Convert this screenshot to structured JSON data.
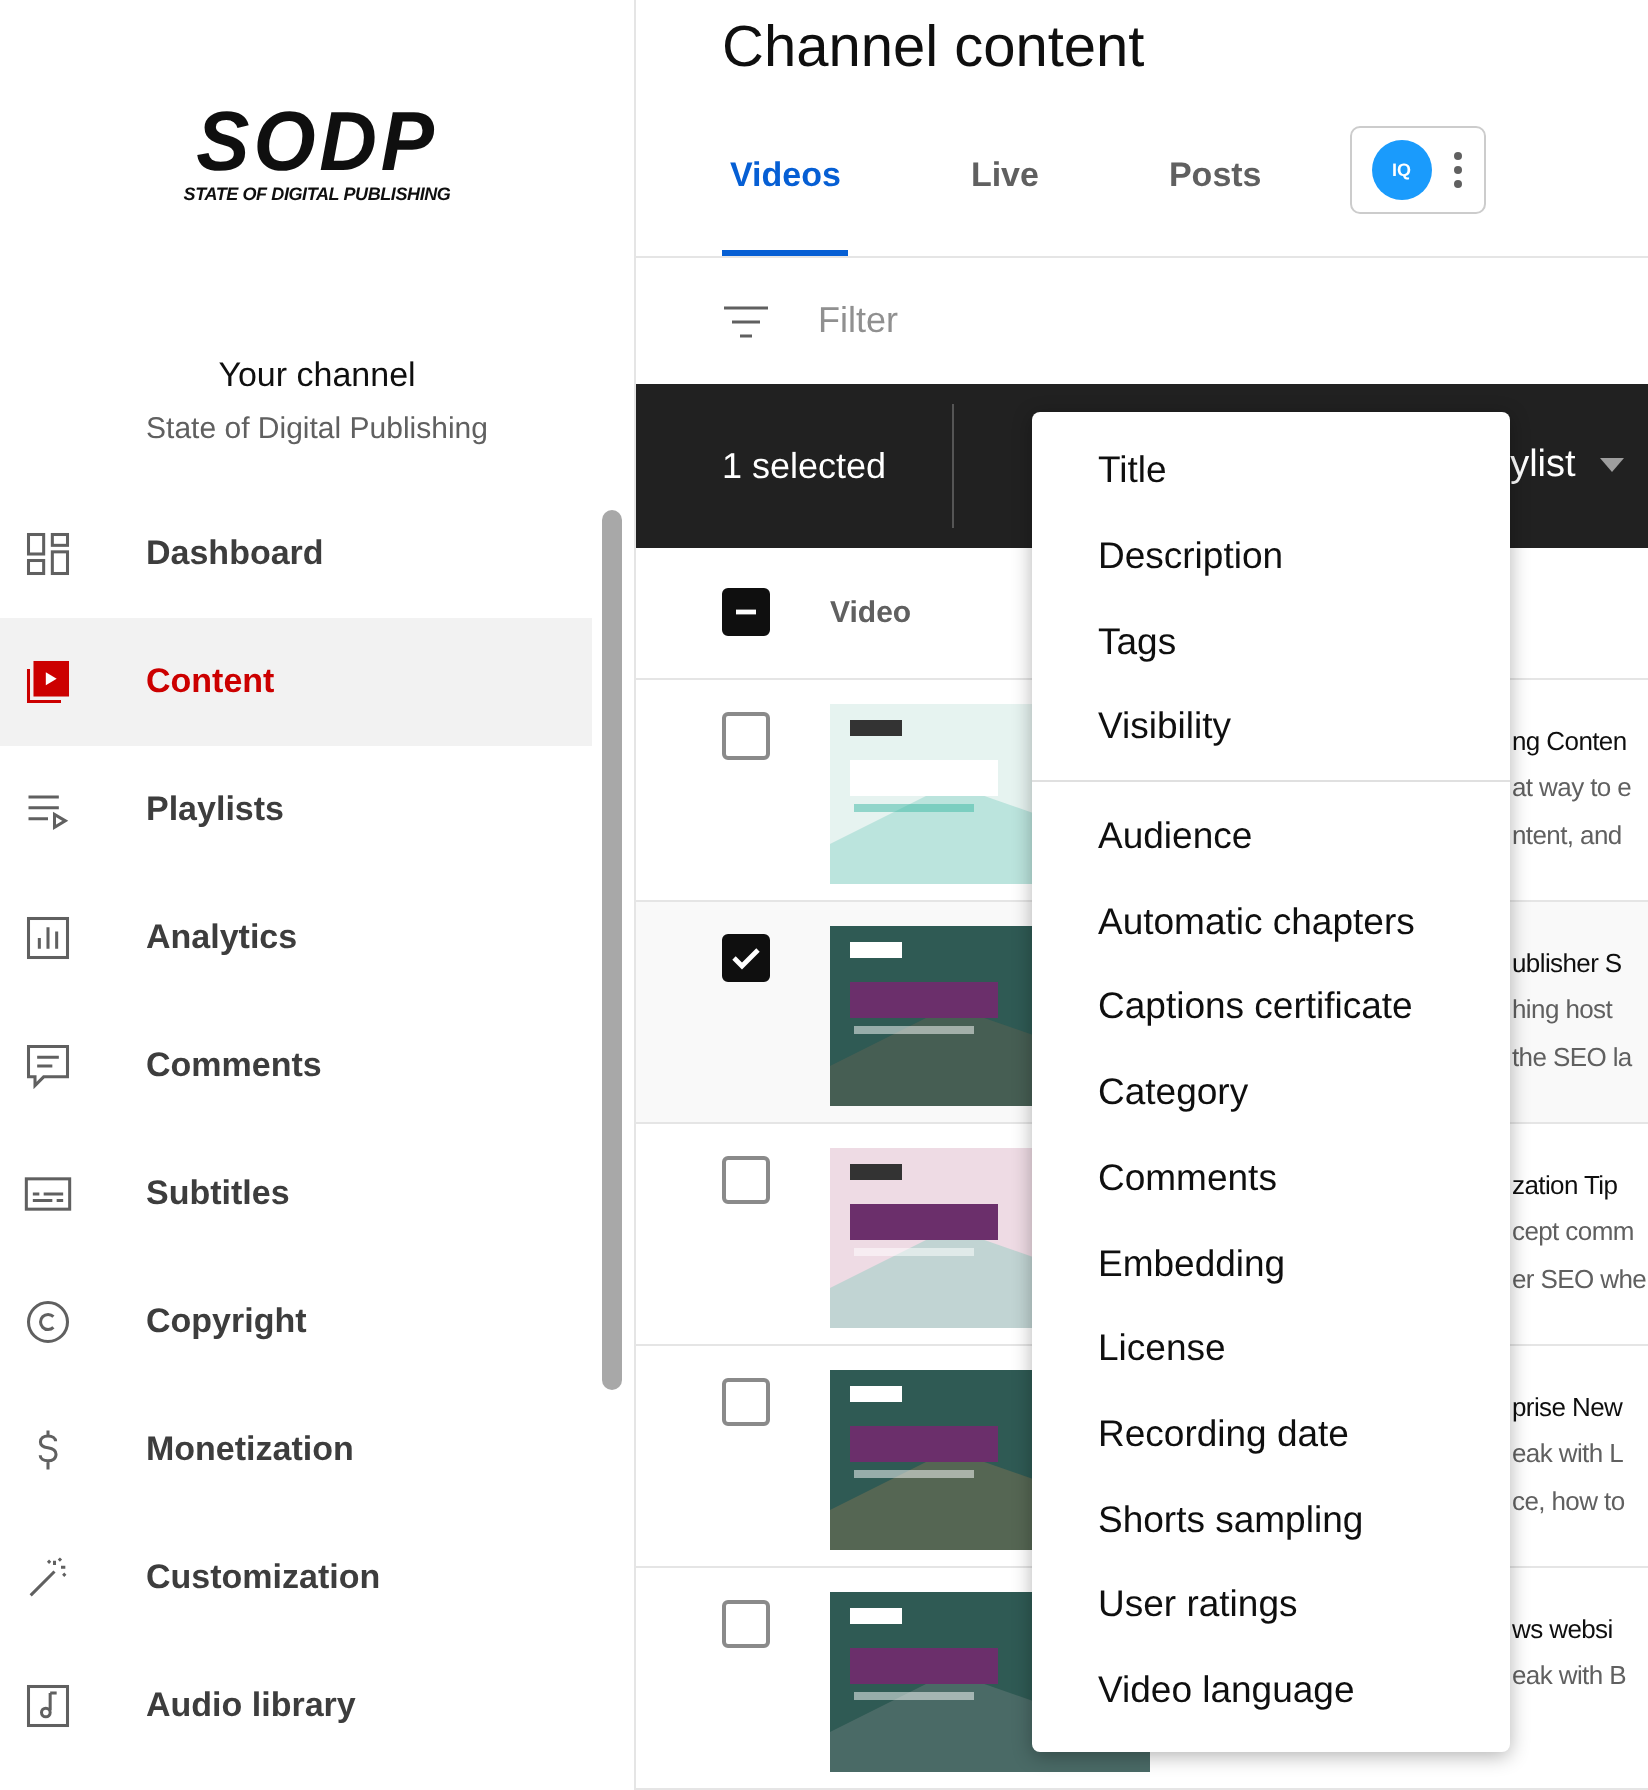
{
  "sidebar": {
    "logo": {
      "wordmark": "SODP",
      "tagline": "STATE OF DIGITAL PUBLISHING"
    },
    "channel_label": "Your channel",
    "channel_name": "State of Digital Publishing",
    "items": [
      {
        "label": "Dashboard",
        "selected": false
      },
      {
        "label": "Content",
        "selected": true
      },
      {
        "label": "Playlists",
        "selected": false
      },
      {
        "label": "Analytics",
        "selected": false
      },
      {
        "label": "Comments",
        "selected": false
      },
      {
        "label": "Subtitles",
        "selected": false
      },
      {
        "label": "Copyright",
        "selected": false
      },
      {
        "label": "Monetization",
        "selected": false
      },
      {
        "label": "Customization",
        "selected": false
      },
      {
        "label": "Audio library",
        "selected": false
      }
    ]
  },
  "header": {
    "title": "Channel content"
  },
  "tabs": [
    {
      "label": "Videos",
      "selected": true
    },
    {
      "label": "Live",
      "selected": false
    },
    {
      "label": "Posts",
      "selected": false
    }
  ],
  "extension": {
    "label": "IQ"
  },
  "filter": {
    "placeholder": "Filter"
  },
  "selection_bar": {
    "count": "1 selected",
    "action": "ylist"
  },
  "table": {
    "select_all": {
      "indeterminate": true
    },
    "column": "Video",
    "rows": [
      {
        "checked": false,
        "title": "ng Conten",
        "description": [
          "at way to e",
          "ntent, and"
        ]
      },
      {
        "checked": true,
        "title": "ublisher S",
        "description": [
          "hing host",
          "the SEO la"
        ]
      },
      {
        "checked": false,
        "title": "zation Tip",
        "description": [
          "cept comm",
          "er SEO whe"
        ]
      },
      {
        "checked": false,
        "title": "prise New",
        "description": [
          "eak with L",
          "ce, how to"
        ]
      },
      {
        "checked": false,
        "title": "ws websi",
        "description": [
          "eak with B"
        ]
      }
    ]
  },
  "edit_menu": {
    "groups": [
      [
        "Title",
        "Description",
        "Tags",
        "Visibility"
      ],
      [
        "Audience",
        "Automatic chapters",
        "Captions certificate",
        "Category",
        "Comments",
        "Embedding",
        "License",
        "Recording date",
        "Shorts sampling",
        "User ratings",
        "Video language"
      ]
    ]
  }
}
